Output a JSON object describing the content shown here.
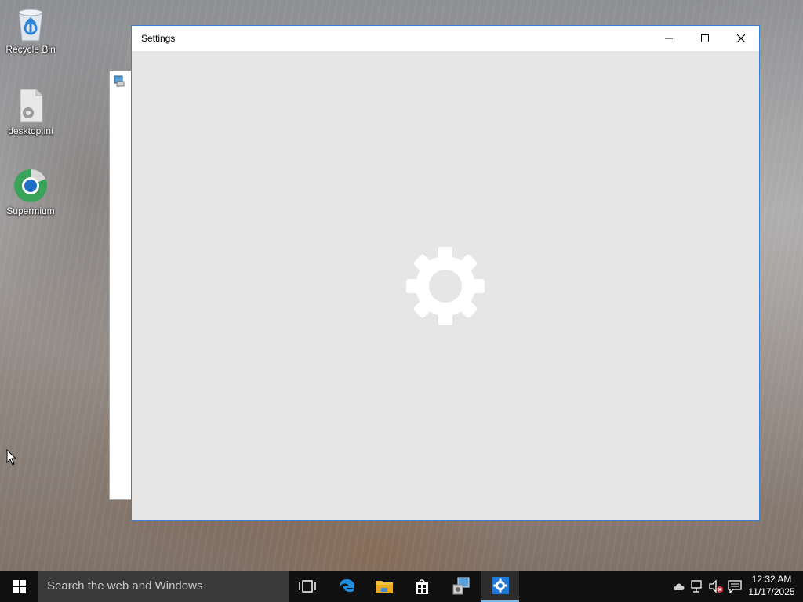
{
  "desktop": {
    "icons": [
      {
        "label": "Recycle Bin",
        "icon": "recycle-bin-icon"
      },
      {
        "label": "desktop.ini",
        "icon": "ini-file-icon"
      },
      {
        "label": "Supermium",
        "icon": "supermium-browser-icon"
      }
    ]
  },
  "window": {
    "title": "Settings",
    "content_icon": "gear-icon",
    "controls": [
      "minimize-icon",
      "maximize-icon",
      "close-icon"
    ]
  },
  "taskbar": {
    "search_placeholder": "Search the web and Windows",
    "apps": [
      {
        "name": "task-view",
        "icon": "task-view-icon"
      },
      {
        "name": "edge",
        "icon": "edge-icon"
      },
      {
        "name": "file-explorer",
        "icon": "folder-icon"
      },
      {
        "name": "store",
        "icon": "store-icon"
      },
      {
        "name": "control-panel",
        "icon": "control-panel-icon"
      },
      {
        "name": "settings",
        "icon": "gear-icon",
        "active": true
      }
    ],
    "tray": [
      "cloud-icon",
      "network-icon",
      "volume-muted-icon",
      "action-center-icon"
    ],
    "clock": {
      "time": "12:32 AM",
      "date": "11/17/2025"
    }
  },
  "colors": {
    "accent": "#3c7fd1",
    "active_underline": "#76b9ed"
  }
}
